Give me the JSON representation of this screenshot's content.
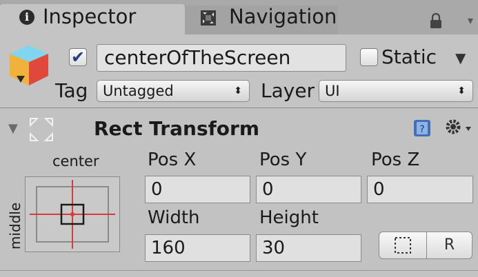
{
  "tabs": {
    "inspector_label": "Inspector",
    "navigation_label": "Navigation"
  },
  "gameobject": {
    "name": "centerOfTheScreen",
    "active": true,
    "static_label": "Static",
    "static": false,
    "tag_label": "Tag",
    "tag_value": "Untagged",
    "layer_label": "Layer",
    "layer_value": "UI"
  },
  "rect_transform": {
    "title": "Rect Transform",
    "anchor_horizontal": "center",
    "anchor_vertical": "middle",
    "pos_x_label": "Pos X",
    "pos_y_label": "Pos Y",
    "pos_z_label": "Pos Z",
    "pos_x": "0",
    "pos_y": "0",
    "pos_z": "0",
    "width_label": "Width",
    "height_label": "Height",
    "width": "160",
    "height": "30",
    "raw_edit_label": "R"
  },
  "colors": {
    "panel": "#c2c2c2",
    "field": "#e0e0e0",
    "check": "#243c84",
    "anchor_line": "#d83a3a"
  },
  "icons": [
    "info-icon",
    "navigation-icon",
    "lock-icon",
    "gameobject-cube-icon",
    "rect-transform-icon",
    "help-book-icon",
    "gear-icon",
    "blueprint-icon"
  ]
}
